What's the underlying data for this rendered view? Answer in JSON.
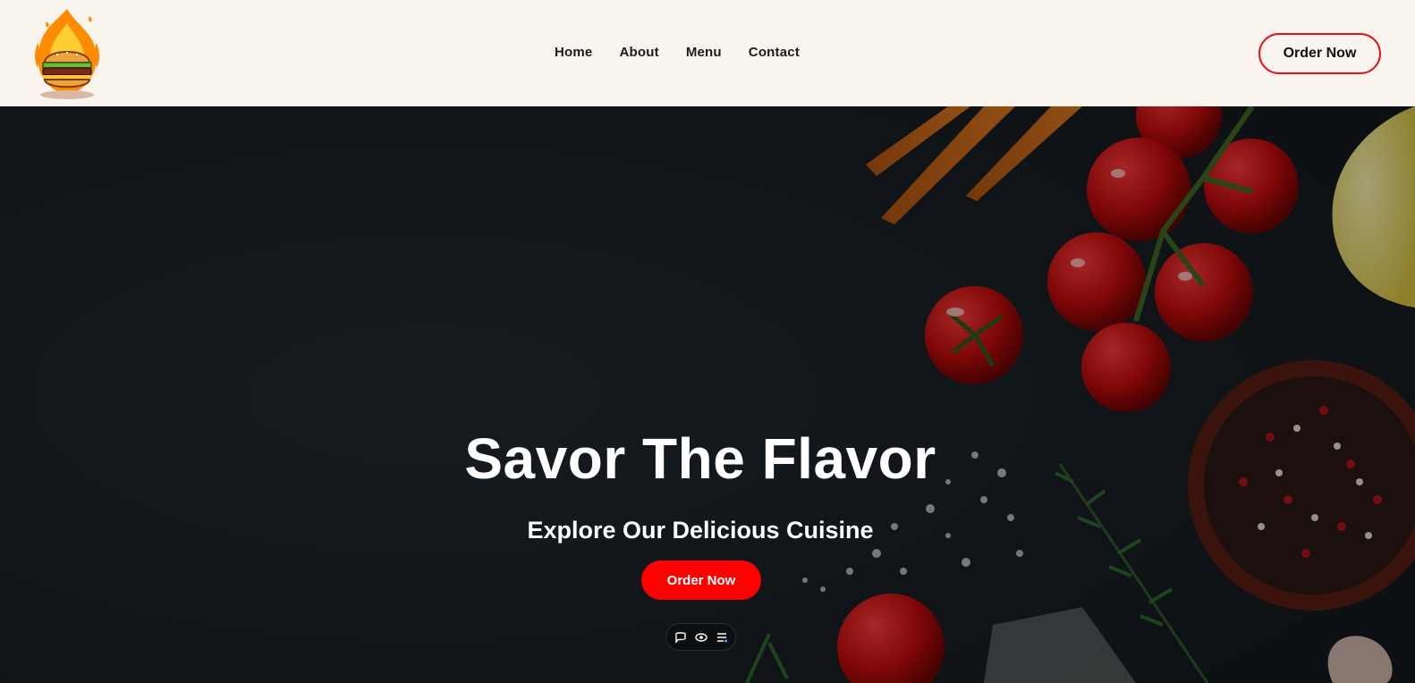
{
  "header": {
    "logo": "burger-flame-logo",
    "nav": [
      "Home",
      "About",
      "Menu",
      "Contact"
    ],
    "order_button": "Order Now"
  },
  "hero": {
    "title": "Savor The Flavor",
    "subtitle": "Explore Our Delicious Cuisine",
    "order_button": "Order Now"
  },
  "toolbar": {
    "icons": [
      "comment-icon",
      "eye-icon",
      "menu-lines-icon"
    ]
  },
  "colors": {
    "header_bg": "#f9f5ee",
    "accent_red": "#fe0000",
    "hero_bg": "#1b2126"
  }
}
